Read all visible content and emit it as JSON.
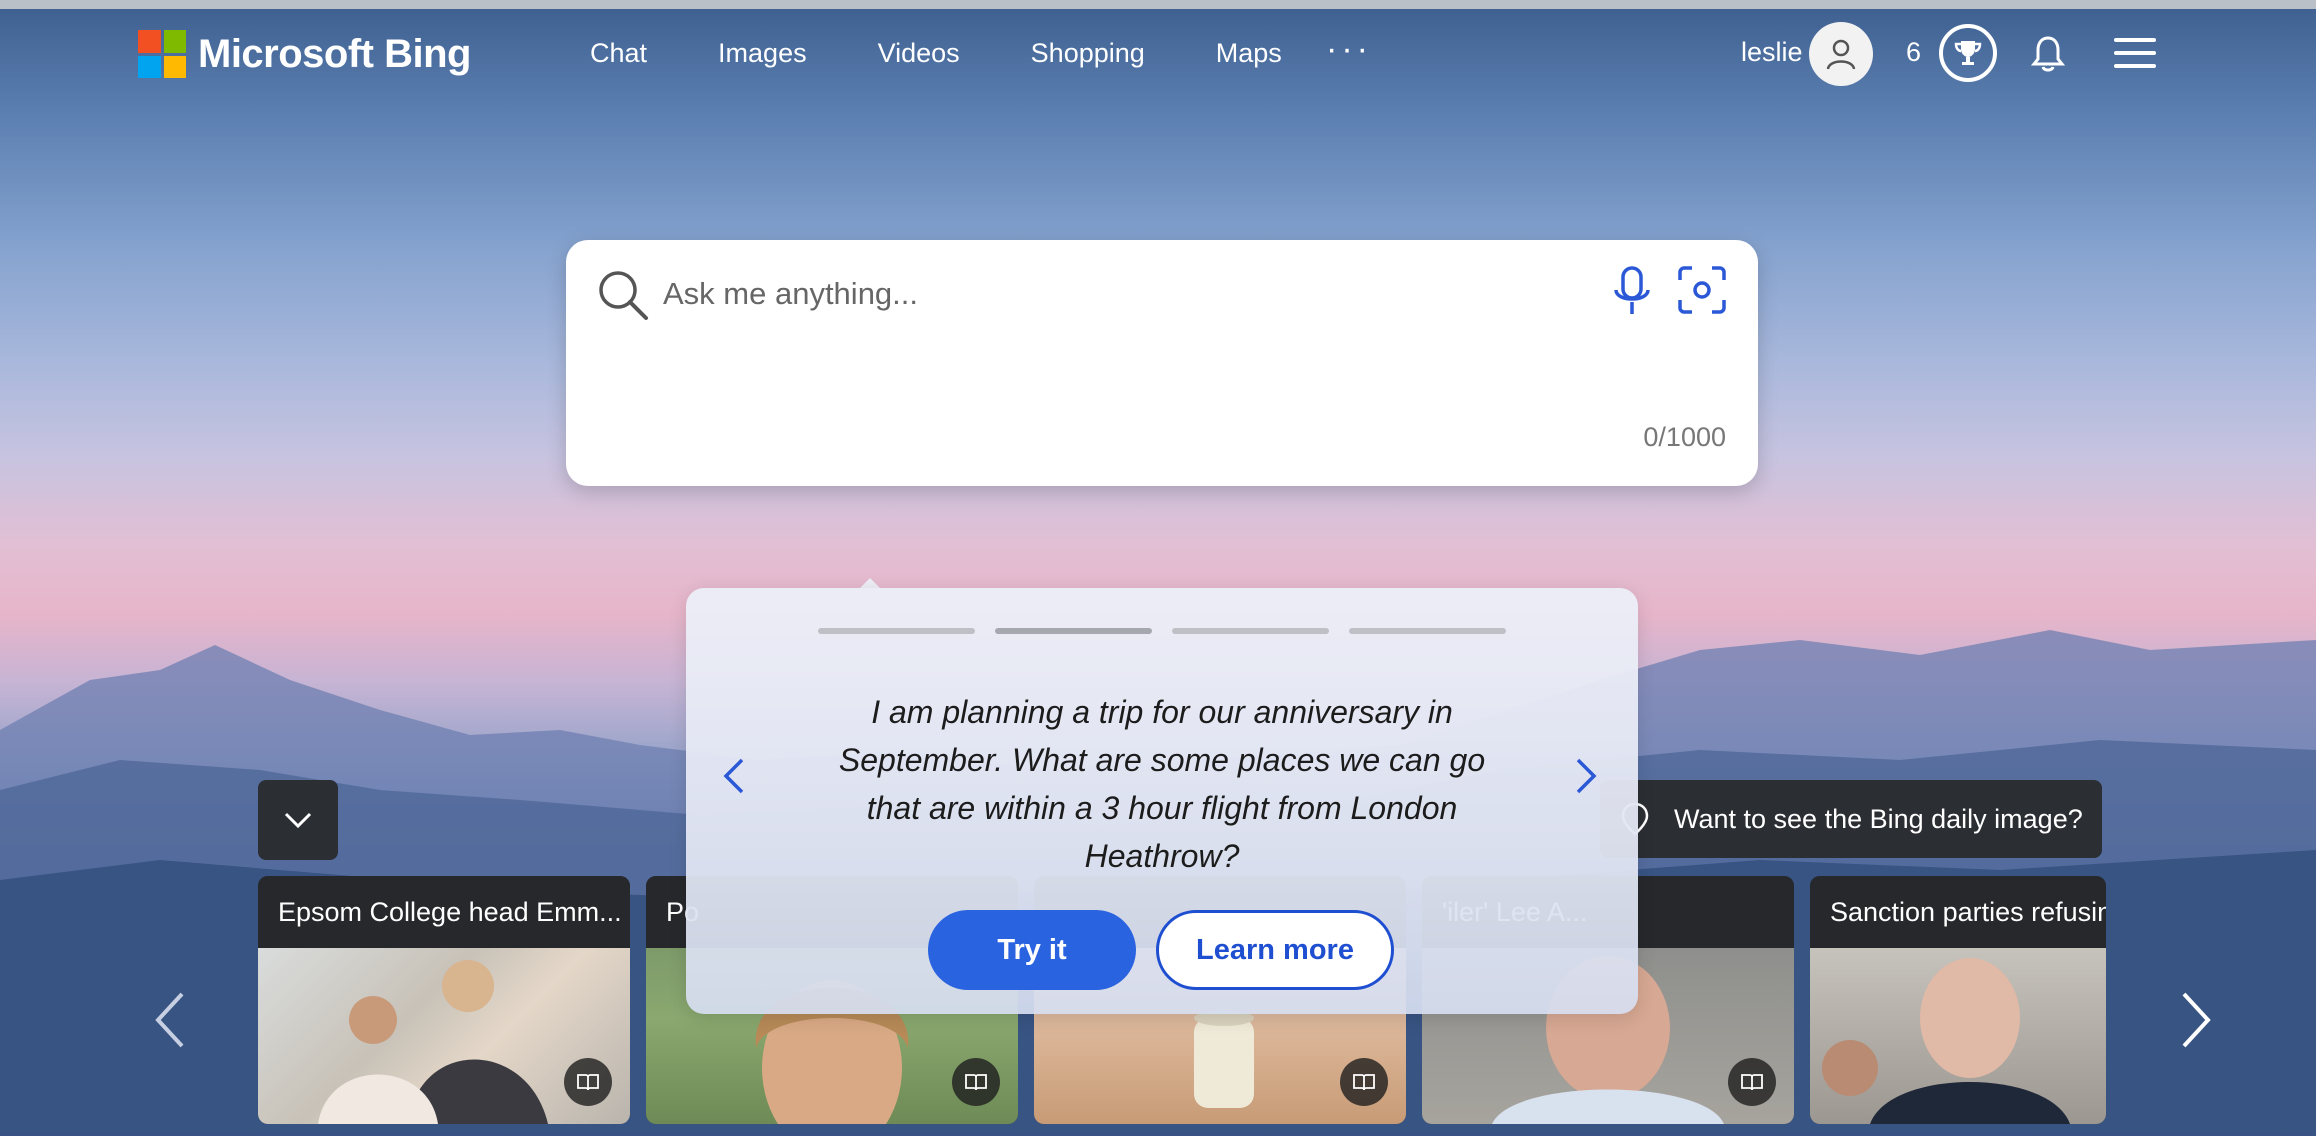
{
  "brand": {
    "name": "Microsoft Bing",
    "logo_colors": [
      "#f25022",
      "#7fba00",
      "#00a4ef",
      "#ffb900"
    ]
  },
  "nav": {
    "items": [
      {
        "label": "Chat"
      },
      {
        "label": "Images"
      },
      {
        "label": "Videos"
      },
      {
        "label": "Shopping"
      },
      {
        "label": "Maps"
      }
    ],
    "more_label": "···"
  },
  "user": {
    "name": "leslie",
    "points": "6"
  },
  "search": {
    "placeholder": "Ask me anything...",
    "char_count": "0/1000"
  },
  "tip": {
    "text": "I am planning a trip for our anniversary in September. What are some places we can go that are within a 3 hour flight from London Heathrow?",
    "try_label": "Try it",
    "learn_label": "Learn more",
    "total_steps": 4,
    "active_step": 2
  },
  "daily_image": {
    "label": "Want to see the Bing daily image?"
  },
  "news": [
    {
      "title": "Epsom College head Emm..."
    },
    {
      "title": "Po"
    },
    {
      "title": ""
    },
    {
      "title": "'iler' Lee A..."
    },
    {
      "title": "Sanction parties refusing"
    }
  ],
  "colors": {
    "accent": "#2a63e0",
    "dark_pill": "#2b2e33"
  }
}
